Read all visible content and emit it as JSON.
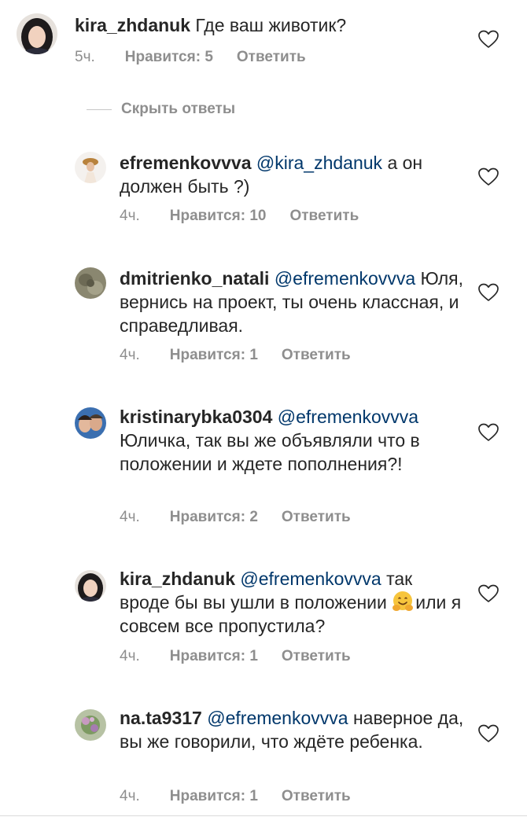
{
  "comments": [
    {
      "username": "kira_zhdanuk",
      "mention": "",
      "text": "Где ваш животик?",
      "time": "5ч.",
      "likes": "Нравится: 5",
      "reply": "Ответить"
    },
    {
      "username": "efremenkovvva",
      "mention": "@kira_zhdanuk",
      "text": "а он должен быть ?)",
      "time": "4ч.",
      "likes": "Нравится: 10",
      "reply": "Ответить"
    },
    {
      "username": "dmitrienko_natali",
      "mention": "@efremenkovvva",
      "text": "Юля, вернись на проект, ты очень классная, и справедливая.",
      "time": "4ч.",
      "likes": "Нравится: 1",
      "reply": "Ответить"
    },
    {
      "username": "kristinarybka0304",
      "mention": "@efremenkovvva",
      "text": "Юличка, так вы же объявляли что в положении и ждете пополнения?!",
      "time": "4ч.",
      "likes": "Нравится: 2",
      "reply": "Ответить"
    },
    {
      "username": "kira_zhdanuk",
      "mention": "@efremenkovvva",
      "text": "так вроде бы вы ушли в положении",
      "text_after_emoji": "или я совсем все пропустила?",
      "emoji": "hugging-face-emoji",
      "time": "4ч.",
      "likes": "Нравится: 1",
      "reply": "Ответить"
    },
    {
      "username": "na.ta9317",
      "mention": "@efremenkovvva",
      "text": "наверное да, вы же говорили, что ждёте ребенка.",
      "time": "4ч.",
      "likes": "Нравится: 1",
      "reply": "Ответить"
    }
  ],
  "hide_replies_label": "Скрыть ответы",
  "icons": {
    "like": "heart-outline-icon"
  },
  "colors": {
    "text": "#262626",
    "secondary": "#8e8e8e",
    "mention": "#00376b"
  }
}
